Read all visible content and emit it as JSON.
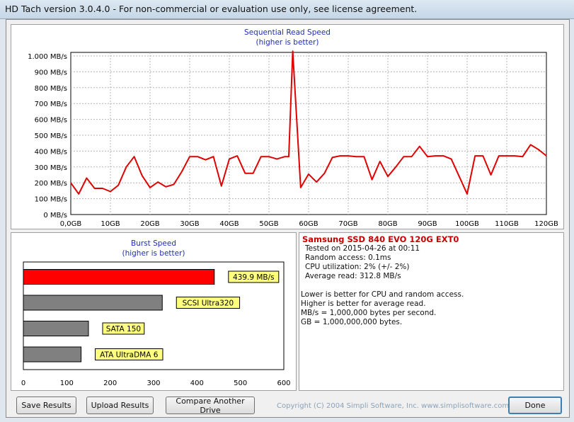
{
  "window": {
    "title": "HD Tach version 3.0.4.0  - For non-commercial or evaluation use only, see license agreement."
  },
  "sequential_chart": {
    "title": "Sequential Read Speed",
    "subtitle": "(higher is better)",
    "y_ticks": [
      "0 MB/s",
      "100 MB/s",
      "200 MB/s",
      "300 MB/s",
      "400 MB/s",
      "500 MB/s",
      "600 MB/s",
      "700 MB/s",
      "800 MB/s",
      "900 MB/s",
      "1.000 MB/s"
    ],
    "x_ticks": [
      "0,0GB",
      "10GB",
      "20GB",
      "30GB",
      "40GB",
      "50GB",
      "60GB",
      "70GB",
      "80GB",
      "90GB",
      "100GB",
      "110GB",
      "120GB"
    ],
    "line_color": "#e00000"
  },
  "burst_chart": {
    "title": "Burst Speed",
    "subtitle": "(higher is better)",
    "x_ticks": [
      "0",
      "100",
      "200",
      "300",
      "400",
      "500",
      "600"
    ],
    "highlight_color": "#ff0000",
    "reference_color": "#808080",
    "label_bg": "#ffff80"
  },
  "chart_data": [
    {
      "type": "line",
      "title": "Sequential Read Speed",
      "subtitle": "(higher is better)",
      "xlabel": "",
      "ylabel": "",
      "x_unit": "GB",
      "y_unit": "MB/s",
      "xlim": [
        0,
        120
      ],
      "ylim": [
        0,
        1000
      ],
      "grid": true,
      "series": [
        {
          "points": [
            [
              0,
              200
            ],
            [
              2,
              130
            ],
            [
              4,
              230
            ],
            [
              6,
              165
            ],
            [
              8,
              165
            ],
            [
              10,
              145
            ],
            [
              12,
              185
            ],
            [
              14,
              300
            ],
            [
              16,
              365
            ],
            [
              18,
              245
            ],
            [
              20,
              170
            ],
            [
              22,
              205
            ],
            [
              24,
              175
            ],
            [
              26,
              190
            ],
            [
              28,
              270
            ],
            [
              30,
              365
            ],
            [
              32,
              365
            ],
            [
              34,
              345
            ],
            [
              36,
              365
            ],
            [
              38,
              180
            ],
            [
              40,
              350
            ],
            [
              42,
              370
            ],
            [
              44,
              260
            ],
            [
              46,
              260
            ],
            [
              48,
              365
            ],
            [
              50,
              365
            ],
            [
              52,
              350
            ],
            [
              54,
              365
            ],
            [
              55,
              365
            ],
            [
              56,
              1030
            ],
            [
              58,
              170
            ],
            [
              60,
              255
            ],
            [
              62,
              205
            ],
            [
              64,
              260
            ],
            [
              66,
              360
            ],
            [
              68,
              370
            ],
            [
              70,
              370
            ],
            [
              72,
              365
            ],
            [
              74,
              365
            ],
            [
              76,
              220
            ],
            [
              78,
              335
            ],
            [
              80,
              240
            ],
            [
              82,
              300
            ],
            [
              84,
              365
            ],
            [
              86,
              365
            ],
            [
              88,
              430
            ],
            [
              90,
              365
            ],
            [
              92,
              370
            ],
            [
              94,
              370
            ],
            [
              96,
              350
            ],
            [
              98,
              240
            ],
            [
              100,
              130
            ],
            [
              102,
              370
            ],
            [
              104,
              370
            ],
            [
              106,
              250
            ],
            [
              108,
              370
            ],
            [
              110,
              370
            ],
            [
              112,
              370
            ],
            [
              114,
              365
            ],
            [
              116,
              440
            ],
            [
              118,
              410
            ],
            [
              120,
              370
            ],
            [
              122,
              370
            ],
            [
              124,
              370
            ]
          ]
        }
      ]
    },
    {
      "type": "bar",
      "orientation": "horizontal",
      "title": "Burst Speed",
      "subtitle": "(higher is better)",
      "xlim": [
        0,
        600
      ],
      "categories": [
        "439.9 MB/s",
        "SCSI Ultra320",
        "SATA 150",
        "ATA UltraDMA 6"
      ],
      "values": [
        439.9,
        320,
        150,
        133
      ]
    }
  ],
  "info": {
    "drive_name": "Samsung SSD 840 EVO 120G EXT0",
    "lines": [
      "Tested on 2015-04-26 at 00:11",
      "Random access: 0.1ms",
      "CPU utilization: 2% (+/- 2%)",
      "Average read: 312.8 MB/s"
    ],
    "notes": [
      "Lower is better for CPU and random access.",
      "Higher is better for average read.",
      "MB/s = 1,000,000 bytes per second.",
      "GB = 1,000,000,000 bytes."
    ]
  },
  "footer": {
    "save_label": "Save Results",
    "upload_label": "Upload Results",
    "compare_label": "Compare Another Drive",
    "copyright": "Copyright (C) 2004 Simpli Software, Inc. www.simplisoftware.com",
    "done_label": "Done"
  }
}
